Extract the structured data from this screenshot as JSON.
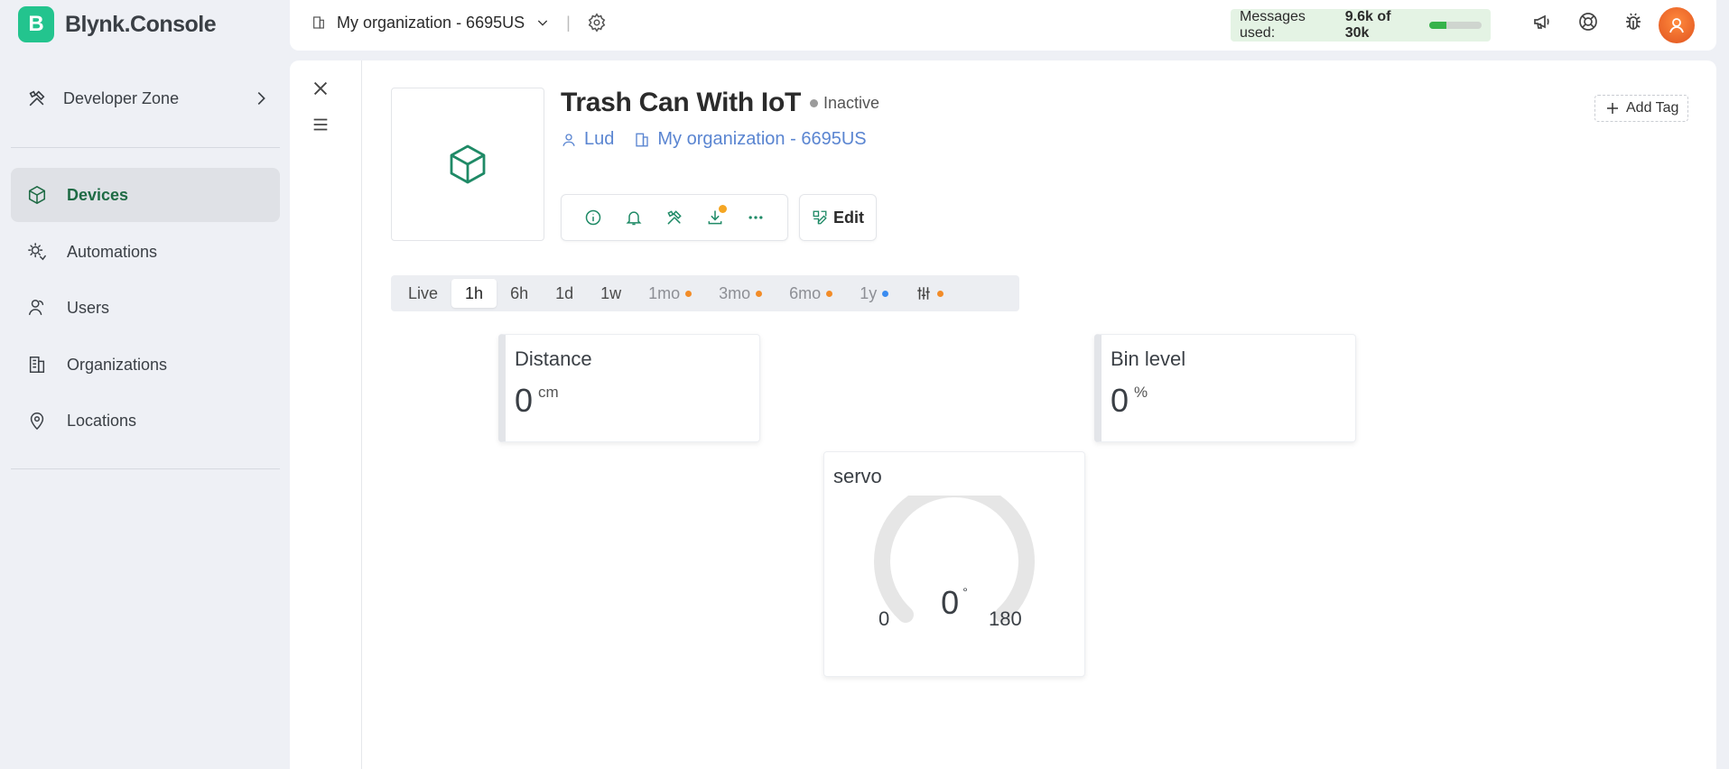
{
  "brand": {
    "logo_letter": "B",
    "name": "Blynk.Console",
    "color": "#23c48e"
  },
  "sidebar": {
    "developer_zone": "Developer Zone",
    "items": [
      {
        "label": "Devices",
        "icon": "cube-icon",
        "active": true
      },
      {
        "label": "Automations",
        "icon": "automation-icon",
        "active": false
      },
      {
        "label": "Users",
        "icon": "users-icon",
        "active": false
      },
      {
        "label": "Organizations",
        "icon": "building-icon",
        "active": false
      },
      {
        "label": "Locations",
        "icon": "location-pin-icon",
        "active": false
      }
    ]
  },
  "header": {
    "org_name": "My organization - 6695US",
    "messages_label": "Messages used:",
    "messages_value": "9.6k of 30k",
    "messages_fraction": 0.32
  },
  "device": {
    "title": "Trash Can With IoT",
    "status": "Inactive",
    "owner": "Lud",
    "organization": "My organization - 6695US",
    "add_tag": "Add Tag",
    "edit": "Edit"
  },
  "time_tabs": [
    {
      "label": "Live",
      "active": false,
      "muted": false,
      "dot": null
    },
    {
      "label": "1h",
      "active": true,
      "muted": false,
      "dot": null
    },
    {
      "label": "6h",
      "active": false,
      "muted": false,
      "dot": null
    },
    {
      "label": "1d",
      "active": false,
      "muted": false,
      "dot": null
    },
    {
      "label": "1w",
      "active": false,
      "muted": false,
      "dot": null
    },
    {
      "label": "1mo",
      "active": false,
      "muted": true,
      "dot": "#f28c28"
    },
    {
      "label": "3mo",
      "active": false,
      "muted": true,
      "dot": "#f28c28"
    },
    {
      "label": "6mo",
      "active": false,
      "muted": true,
      "dot": "#f28c28"
    },
    {
      "label": "1y",
      "active": false,
      "muted": true,
      "dot": "#3b8cf0"
    }
  ],
  "custom_range_dot": "#f28c28",
  "widgets": {
    "distance": {
      "title": "Distance",
      "value": "0",
      "unit": "cm"
    },
    "bin_level": {
      "title": "Bin level",
      "value": "0",
      "unit": "%"
    },
    "servo": {
      "title": "servo",
      "value": "0",
      "unit": "°",
      "min": "0",
      "max": "180"
    }
  }
}
